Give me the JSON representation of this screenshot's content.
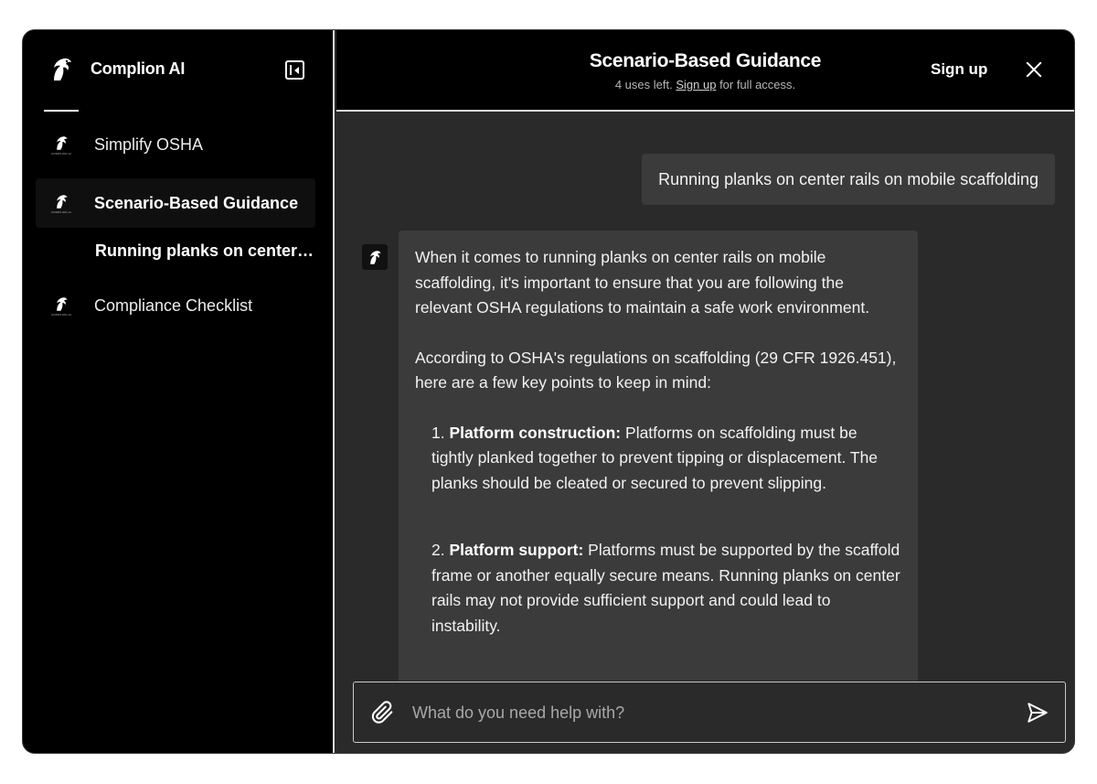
{
  "app": {
    "name": "Complion AI"
  },
  "sidebar": {
    "items": [
      {
        "label": "Simplify OSHA",
        "logo_caption": "COMPLION.AI"
      },
      {
        "label": "Scenario-Based Guidance",
        "logo_caption": "COMPLION.AI",
        "active": true
      },
      {
        "label": "Compliance Checklist",
        "logo_caption": "COMPLION.AI"
      }
    ],
    "sub_item": "Running planks on center rails on mobile scaffolding"
  },
  "header": {
    "title": "Scenario-Based Guidance",
    "uses_left": "4 uses left.",
    "signup_link": "Sign up",
    "full_access": "for full access.",
    "signup_button": "Sign up"
  },
  "chat": {
    "user_message": "Running planks on center rails on mobile scaffolding",
    "bot": {
      "intro": "When it comes to running planks on center rails on mobile scaffolding, it's important to ensure that you are following the relevant OSHA regulations to maintain a safe work environment.",
      "lead": "According to OSHA's regulations on scaffolding (29 CFR 1926.451), here are a few key points to keep in mind:",
      "points": [
        {
          "num": "1.",
          "title": "Platform construction:",
          "text": "Platforms on scaffolding must be tightly planked together to prevent tipping or displacement. The planks should be cleated or secured to prevent slipping."
        },
        {
          "num": "2.",
          "title": "Platform support:",
          "text": "Platforms must be supported by the scaffold frame or another equally secure means. Running planks on center rails may not provide sufficient support and could lead to instability."
        }
      ]
    }
  },
  "composer": {
    "placeholder": "What do you need help with?"
  },
  "colors": {
    "sidebar_bg": "#000000",
    "main_bg": "#2a2a2a",
    "bubble_bg": "#3b3b3b",
    "text": "#ffffff"
  },
  "icons": [
    "horse-logo-icon",
    "sidebar-collapse-icon",
    "close-icon",
    "paperclip-icon",
    "send-icon"
  ]
}
